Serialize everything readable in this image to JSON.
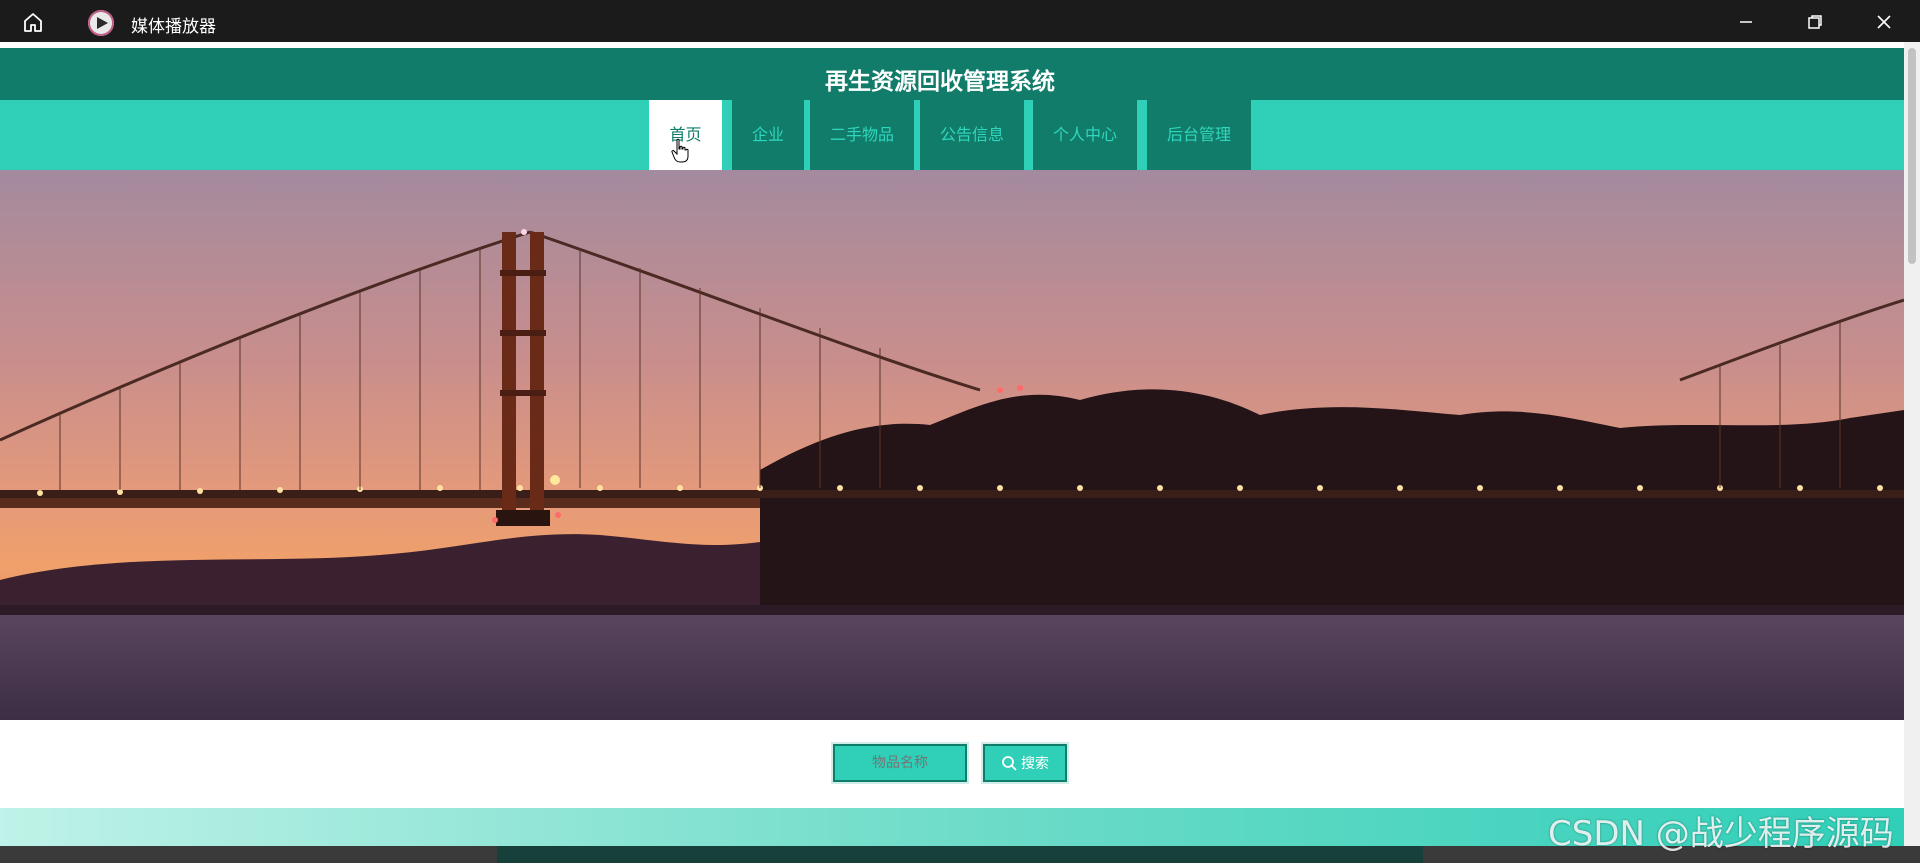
{
  "window": {
    "app_title": "媒体播放器"
  },
  "site": {
    "title": "再生资源回收管理系统"
  },
  "nav": {
    "items": [
      {
        "label": "首页",
        "active": true
      },
      {
        "label": "企业"
      },
      {
        "label": "二手物品"
      },
      {
        "label": "公告信息"
      },
      {
        "label": "个人中心"
      },
      {
        "label": "后台管理"
      }
    ]
  },
  "carousel": {
    "slide_count": 3,
    "active_index": 2
  },
  "search": {
    "placeholder": "物品名称",
    "button_label": "搜索"
  },
  "watermark": "CSDN @战少程序源码",
  "colors": {
    "header_dark": "#127c6a",
    "nav_accent": "#2fcfb8",
    "titlebar": "#1b1b1b"
  }
}
